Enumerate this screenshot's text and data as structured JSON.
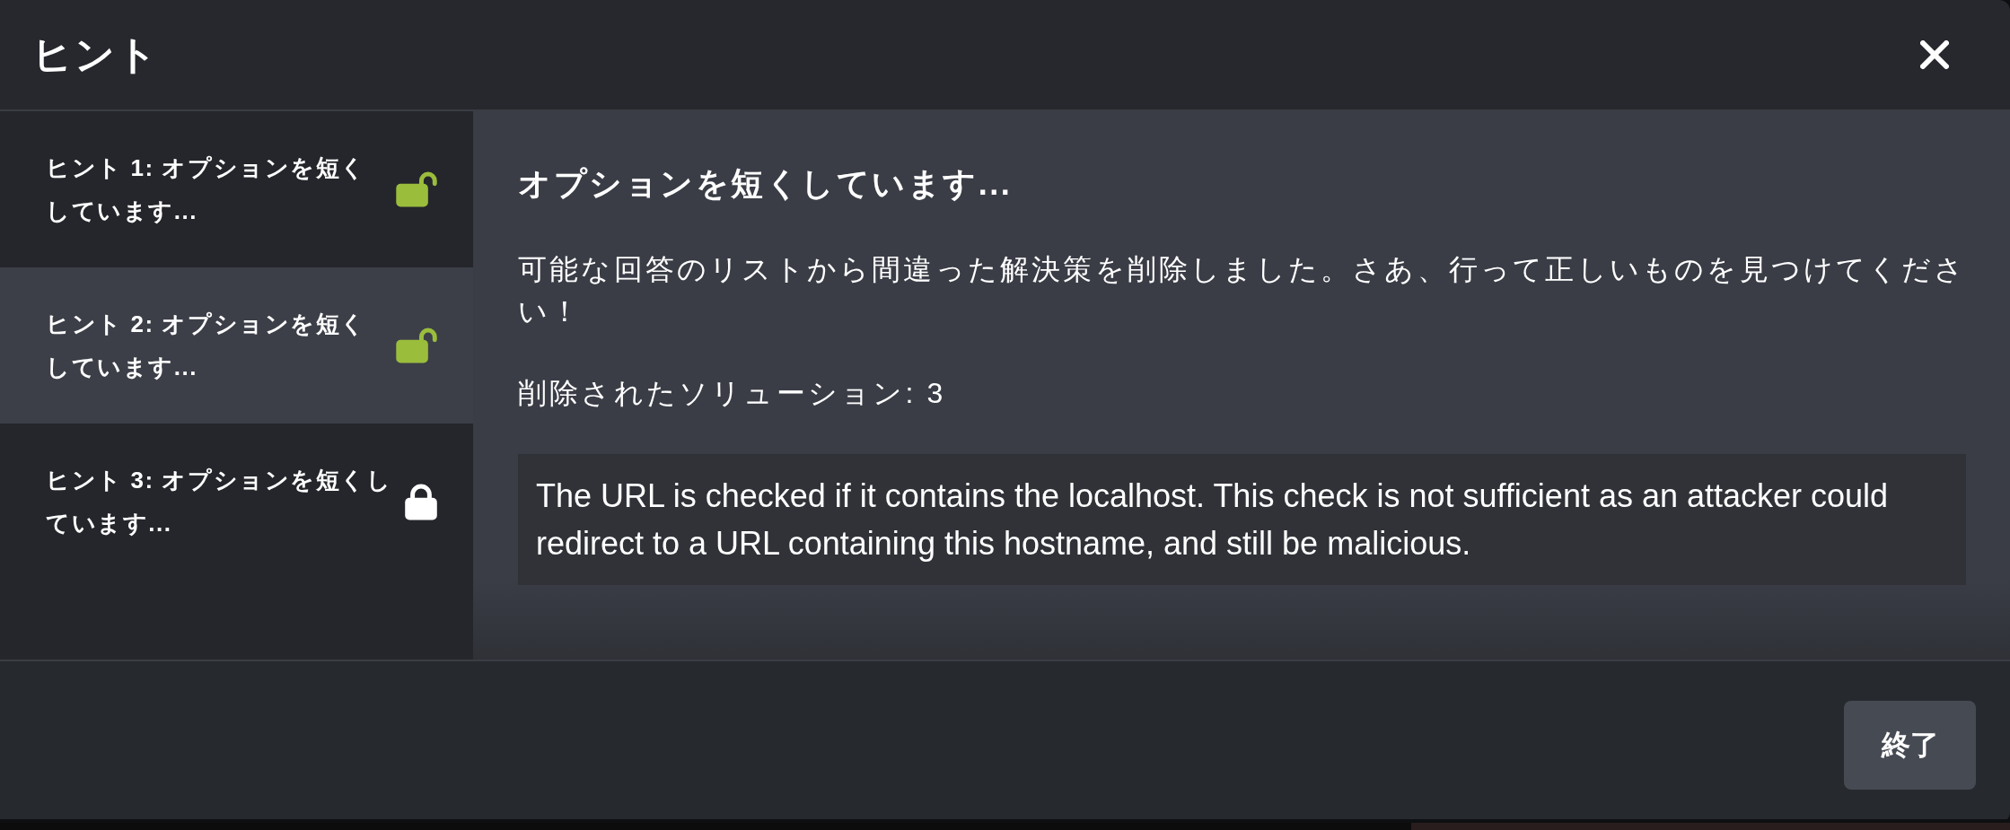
{
  "dialog": {
    "title": "ヒント"
  },
  "hints": [
    {
      "label": "ヒント 1: オプションを短くしています...",
      "selected": false,
      "locked": false
    },
    {
      "label": "ヒント 2: オプションを短くしています...",
      "selected": true,
      "locked": false
    },
    {
      "label": "ヒント 3: オプションを短くしています...",
      "selected": false,
      "locked": true
    }
  ],
  "content": {
    "heading": "オプションを短くしています...",
    "description": "可能な回答のリストから間違った解決策を削除しました。さあ、行って正しいものを見つけてください！",
    "removed_solutions": "削除されたソリューション: 3",
    "explanation": "The URL is checked if it contains the localhost. This check is not sufficient as an attacker could redirect to a URL containing this hostname, and still be malicious."
  },
  "footer": {
    "button": "終了"
  }
}
